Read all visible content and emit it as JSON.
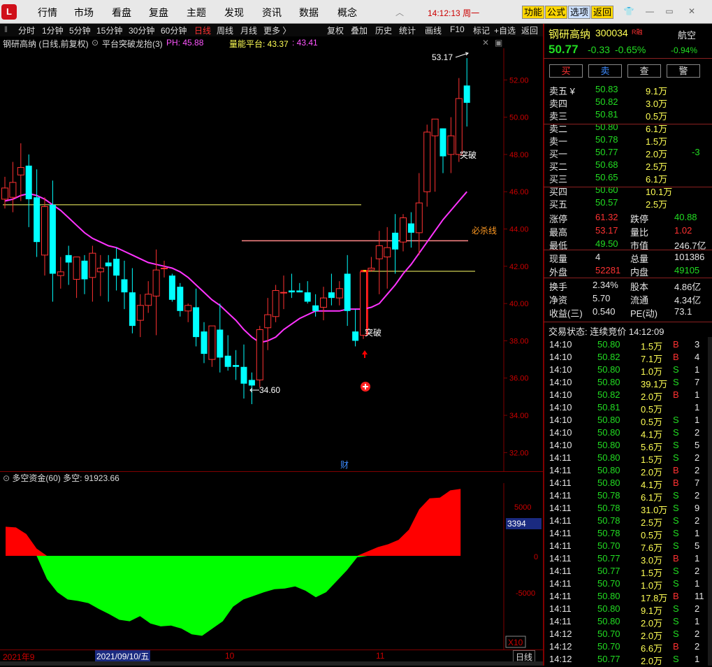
{
  "app": {
    "logo": "L",
    "menu": [
      "行情",
      "市场",
      "看盘",
      "复盘",
      "主题",
      "发现",
      "资讯",
      "数据",
      "概念"
    ],
    "time": "14:12:13",
    "weekday": "周一",
    "right_buttons": [
      "功能",
      "公式",
      "选项",
      "返回"
    ]
  },
  "toolbar": {
    "periods": [
      "分时",
      "1分钟",
      "5分钟",
      "15分钟",
      "30分钟",
      "60分钟",
      "日线",
      "周线",
      "月线",
      "更多 〉"
    ],
    "active_period": "日线",
    "right": [
      "复权",
      "叠加",
      "历史",
      "统计",
      "画线",
      "F10",
      "标记",
      "+自选",
      "返回"
    ]
  },
  "stock": {
    "name": "钢研高纳",
    "code": "300034",
    "tag": "R",
    "tag2": "融",
    "sector": "航空",
    "price": "50.77",
    "change": "-0.33",
    "change_pct": "-0.65%",
    "sector_change": "-0.94%"
  },
  "actions": [
    "买",
    "卖",
    "查",
    "警"
  ],
  "legend": {
    "title": "钢研高纳 (日线,前复权)",
    "indicator": "平台突破龙抬(3)",
    "ph_label": "PH: 45.88",
    "platform_label": "量能平台: 43.37",
    "platform_value2": ": 43.41"
  },
  "chart_labels": {
    "high_mark": "53.17",
    "low_mark": "34.60",
    "break_label_1": "突破",
    "break_label_2": "突破",
    "kill_line": "必杀线",
    "cai": "财",
    "y_ticks": [
      "52.00",
      "50.00",
      "48.00",
      "46.00",
      "44.00",
      "42.00",
      "40.00",
      "38.00",
      "36.00",
      "34.00",
      "32.00"
    ],
    "x_ticks": [
      "2021年9",
      "2021/09/10/五",
      "10",
      "11"
    ],
    "x_unit": "X10",
    "period_tag": "日线"
  },
  "sub_indicator": {
    "name": "多空资金(60)",
    "value_label": "多空: 91923.66",
    "y_ticks": [
      "5000",
      "3394",
      "0",
      "-5000"
    ],
    "current_tag": "3394"
  },
  "orderbook": {
    "asks": [
      {
        "label": "卖五 ¥",
        "price": "50.83",
        "vol": "9.1万"
      },
      {
        "label": "卖四",
        "price": "50.82",
        "vol": "3.0万"
      },
      {
        "label": "卖三",
        "price": "50.81",
        "vol": "0.5万"
      },
      {
        "label": "卖二",
        "price": "50.80",
        "vol": "6.1万"
      },
      {
        "label": "卖一",
        "price": "50.78",
        "vol": "1.5万"
      }
    ],
    "bids": [
      {
        "label": "买一",
        "price": "50.77",
        "vol": "2.0万",
        "diff": "-3"
      },
      {
        "label": "买二",
        "price": "50.68",
        "vol": "2.5万",
        "diff": ""
      },
      {
        "label": "买三",
        "price": "50.65",
        "vol": "6.1万",
        "diff": ""
      },
      {
        "label": "买四",
        "price": "50.60",
        "vol": "10.1万",
        "diff": ""
      },
      {
        "label": "买五",
        "price": "50.57",
        "vol": "2.5万",
        "diff": ""
      }
    ]
  },
  "stats": [
    {
      "l1": "涨停",
      "v1": "61.32",
      "c1": "red",
      "l2": "跌停",
      "v2": "40.88",
      "c2": "grn"
    },
    {
      "l1": "最高",
      "v1": "53.17",
      "c1": "red",
      "l2": "量比",
      "v2": "1.02",
      "c2": "red"
    },
    {
      "l1": "最低",
      "v1": "49.50",
      "c1": "grn",
      "l2": "市值",
      "v2": "246.7亿",
      "c2": "wht"
    },
    {
      "l1": "现量",
      "v1": "4",
      "c1": "wht",
      "l2": "总量",
      "v2": "101386",
      "c2": "wht"
    },
    {
      "l1": "外盘",
      "v1": "52281",
      "c1": "red",
      "l2": "内盘",
      "v2": "49105",
      "c2": "grn"
    }
  ],
  "stats2": [
    {
      "l1": "换手",
      "v1": "2.34%",
      "l2": "股本",
      "v2": "4.86亿"
    },
    {
      "l1": "净资",
      "v1": "5.70",
      "l2": "流通",
      "v2": "4.34亿"
    },
    {
      "l1": "收益(三)",
      "v1": "0.540",
      "l2": "PE(动)",
      "v2": "73.1"
    }
  ],
  "trade_status": "交易状态: 连续竞价 14:12:09",
  "ticks": [
    {
      "t": "14:10",
      "p": "50.80",
      "v": "1.5万",
      "bs": "B",
      "n": "3"
    },
    {
      "t": "14:10",
      "p": "50.82",
      "v": "7.1万",
      "bs": "B",
      "n": "4"
    },
    {
      "t": "14:10",
      "p": "50.80",
      "v": "1.0万",
      "bs": "S",
      "n": "1"
    },
    {
      "t": "14:10",
      "p": "50.80",
      "v": "39.1万",
      "bs": "S",
      "n": "7"
    },
    {
      "t": "14:10",
      "p": "50.82",
      "v": "2.0万",
      "bs": "B",
      "n": "1"
    },
    {
      "t": "14:10",
      "p": "50.81",
      "v": "0.5万",
      "bs": "",
      "n": "1"
    },
    {
      "t": "14:10",
      "p": "50.80",
      "v": "0.5万",
      "bs": "S",
      "n": "1"
    },
    {
      "t": "14:10",
      "p": "50.80",
      "v": "4.1万",
      "bs": "S",
      "n": "2"
    },
    {
      "t": "14:10",
      "p": "50.80",
      "v": "5.6万",
      "bs": "S",
      "n": "5"
    },
    {
      "t": "14:11",
      "p": "50.80",
      "v": "1.5万",
      "bs": "S",
      "n": "2"
    },
    {
      "t": "14:11",
      "p": "50.80",
      "v": "2.0万",
      "bs": "B",
      "n": "2"
    },
    {
      "t": "14:11",
      "p": "50.80",
      "v": "4.1万",
      "bs": "B",
      "n": "7"
    },
    {
      "t": "14:11",
      "p": "50.78",
      "v": "6.1万",
      "bs": "S",
      "n": "2"
    },
    {
      "t": "14:11",
      "p": "50.78",
      "v": "31.0万",
      "bs": "S",
      "n": "9"
    },
    {
      "t": "14:11",
      "p": "50.78",
      "v": "2.5万",
      "bs": "S",
      "n": "2"
    },
    {
      "t": "14:11",
      "p": "50.78",
      "v": "0.5万",
      "bs": "S",
      "n": "1"
    },
    {
      "t": "14:11",
      "p": "50.70",
      "v": "7.6万",
      "bs": "S",
      "n": "5"
    },
    {
      "t": "14:11",
      "p": "50.77",
      "v": "3.0万",
      "bs": "B",
      "n": "1"
    },
    {
      "t": "14:11",
      "p": "50.77",
      "v": "1.5万",
      "bs": "S",
      "n": "2"
    },
    {
      "t": "14:11",
      "p": "50.70",
      "v": "1.0万",
      "bs": "S",
      "n": "1"
    },
    {
      "t": "14:11",
      "p": "50.80",
      "v": "17.8万",
      "bs": "B",
      "n": "11"
    },
    {
      "t": "14:11",
      "p": "50.80",
      "v": "9.1万",
      "bs": "S",
      "n": "2"
    },
    {
      "t": "14:11",
      "p": "50.80",
      "v": "2.0万",
      "bs": "S",
      "n": "1"
    },
    {
      "t": "14:12",
      "p": "50.70",
      "v": "2.0万",
      "bs": "S",
      "n": "2"
    },
    {
      "t": "14:12",
      "p": "50.70",
      "v": "6.6万",
      "bs": "B",
      "n": "2"
    },
    {
      "t": "14:12",
      "p": "50.77",
      "v": "2.0万",
      "bs": "S",
      "n": "1"
    }
  ],
  "chart_data": {
    "type": "candlestick",
    "y_range": [
      31.0,
      53.7
    ],
    "candles": [
      [
        45.6,
        46.8,
        45.1,
        46.2
      ],
      [
        45.7,
        47.6,
        44.9,
        46.5
      ],
      [
        46.9,
        48.6,
        45.5,
        47.3
      ],
      [
        47.4,
        48.0,
        44.1,
        45.6
      ],
      [
        45.7,
        47.2,
        42.5,
        43.3
      ],
      [
        42.6,
        45.7,
        41.5,
        45.2
      ],
      [
        45.3,
        46.6,
        40.1,
        41.6
      ],
      [
        41.5,
        42.5,
        40.8,
        41.7
      ],
      [
        42.6,
        43.1,
        41.0,
        42.2
      ],
      [
        41.3,
        42.1,
        40.3,
        42.5
      ],
      [
        42.3,
        42.6,
        40.5,
        41.3
      ],
      [
        41.4,
        43.1,
        40.1,
        42.7
      ],
      [
        41.7,
        42.6,
        40.4,
        41.9
      ],
      [
        42.2,
        42.6,
        40.1,
        42.0
      ],
      [
        42.4,
        43.0,
        40.7,
        41.5
      ],
      [
        41.3,
        42.3,
        39.7,
        40.6
      ],
      [
        40.6,
        41.9,
        38.4,
        38.8
      ],
      [
        39.1,
        40.5,
        38.2,
        39.9
      ],
      [
        39.9,
        41.2,
        39.5,
        40.5
      ],
      [
        40.4,
        42.9,
        38.3,
        41.8
      ],
      [
        41.9,
        42.3,
        41.4,
        41.9
      ],
      [
        41.5,
        41.6,
        40.1,
        40.2
      ],
      [
        40.9,
        41.1,
        39.3,
        39.6
      ],
      [
        39.6,
        40.0,
        39.0,
        39.9
      ],
      [
        39.8,
        40.8,
        37.7,
        38.2
      ],
      [
        38.5,
        39.0,
        36.8,
        37.3
      ],
      [
        37.0,
        38.8,
        36.6,
        38.8
      ],
      [
        38.6,
        40.0,
        36.3,
        37.1
      ],
      [
        37.2,
        38.3,
        36.4,
        36.6
      ],
      [
        36.7,
        37.5,
        35.9,
        36.6
      ],
      [
        36.6,
        37.8,
        34.9,
        35.7
      ],
      [
        35.9,
        36.3,
        34.6,
        35.6
      ],
      [
        35.9,
        38.8,
        35.5,
        38.6
      ],
      [
        38.7,
        40.3,
        37.5,
        39.4
      ],
      [
        39.3,
        41.0,
        39.0,
        40.7
      ],
      [
        40.6,
        41.5,
        39.7,
        40.6
      ],
      [
        40.7,
        41.6,
        40.3,
        40.6
      ],
      [
        40.7,
        41.1,
        40.6,
        40.6
      ],
      [
        40.6,
        41.2,
        40.0,
        40.1
      ],
      [
        39.9,
        40.5,
        39.3,
        39.6
      ],
      [
        39.8,
        40.9,
        39.1,
        40.3
      ],
      [
        40.6,
        41.6,
        39.9,
        40.3
      ],
      [
        40.3,
        41.2,
        39.9,
        40.8
      ],
      [
        41.6,
        42.6,
        38.8,
        39.6
      ],
      [
        38.5,
        39.7,
        37.7,
        38.0
      ],
      [
        38.3,
        41.8,
        38.1,
        41.7
      ],
      [
        41.8,
        42.5,
        41.7,
        41.9
      ],
      [
        42.4,
        43.9,
        40.5,
        43.1
      ],
      [
        42.5,
        44.1,
        40.8,
        43.0
      ],
      [
        43.8,
        44.8,
        41.6,
        42.9
      ],
      [
        43.3,
        44.8,
        42.8,
        44.6
      ],
      [
        44.3,
        44.9,
        43.0,
        43.8
      ],
      [
        43.8,
        47.0,
        42.6,
        45.4
      ],
      [
        46.0,
        49.6,
        45.2,
        49.2
      ],
      [
        49.0,
        49.8,
        46.0,
        49.9
      ],
      [
        49.4,
        49.4,
        47.0,
        47.9
      ],
      [
        48.0,
        50.0,
        47.0,
        49.0
      ],
      [
        48.0,
        52.1,
        47.6,
        51.0
      ],
      [
        51.7,
        53.17,
        49.5,
        50.77
      ]
    ],
    "ma_line": [
      45.5,
      45.6,
      45.8,
      45.9,
      45.8,
      45.6,
      45.3,
      45.0,
      44.6,
      44.2,
      43.8,
      43.5,
      43.3,
      43.1,
      43.0,
      42.8,
      42.6,
      42.4,
      42.2,
      42.1,
      42.0,
      41.9,
      41.7,
      41.4,
      41.0,
      40.6,
      40.2,
      39.9,
      39.5,
      39.1,
      38.6,
      38.2,
      37.9,
      38.0,
      38.2,
      38.6,
      38.9,
      39.2,
      39.4,
      39.6,
      39.6,
      39.6,
      39.6,
      39.7,
      39.7,
      39.7,
      39.8,
      40.0,
      40.5,
      41.0,
      41.6,
      42.1,
      42.7,
      43.3,
      43.9,
      44.5,
      45.0,
      45.5,
      46.0
    ],
    "ph_line": 45.3,
    "kill_line": 43.37,
    "platform_line": 41.73,
    "sub_bars": [
      4000,
      3900,
      3000,
      1000,
      -3200,
      -5000,
      -6000,
      -6200,
      -6500,
      -7300,
      -8000,
      -8800,
      -9000,
      -8300,
      -9300,
      -9700,
      -9600,
      -10000,
      -10800,
      -11000,
      -10000,
      -9000,
      -7000,
      -6000,
      -5500,
      -5000,
      -4600,
      -4500,
      -4200,
      -4800,
      -5700,
      -5000,
      -3500,
      -2000,
      -200,
      600,
      1200,
      1600,
      2200,
      3600,
      6400,
      7900,
      8000,
      9000,
      9200
    ]
  }
}
